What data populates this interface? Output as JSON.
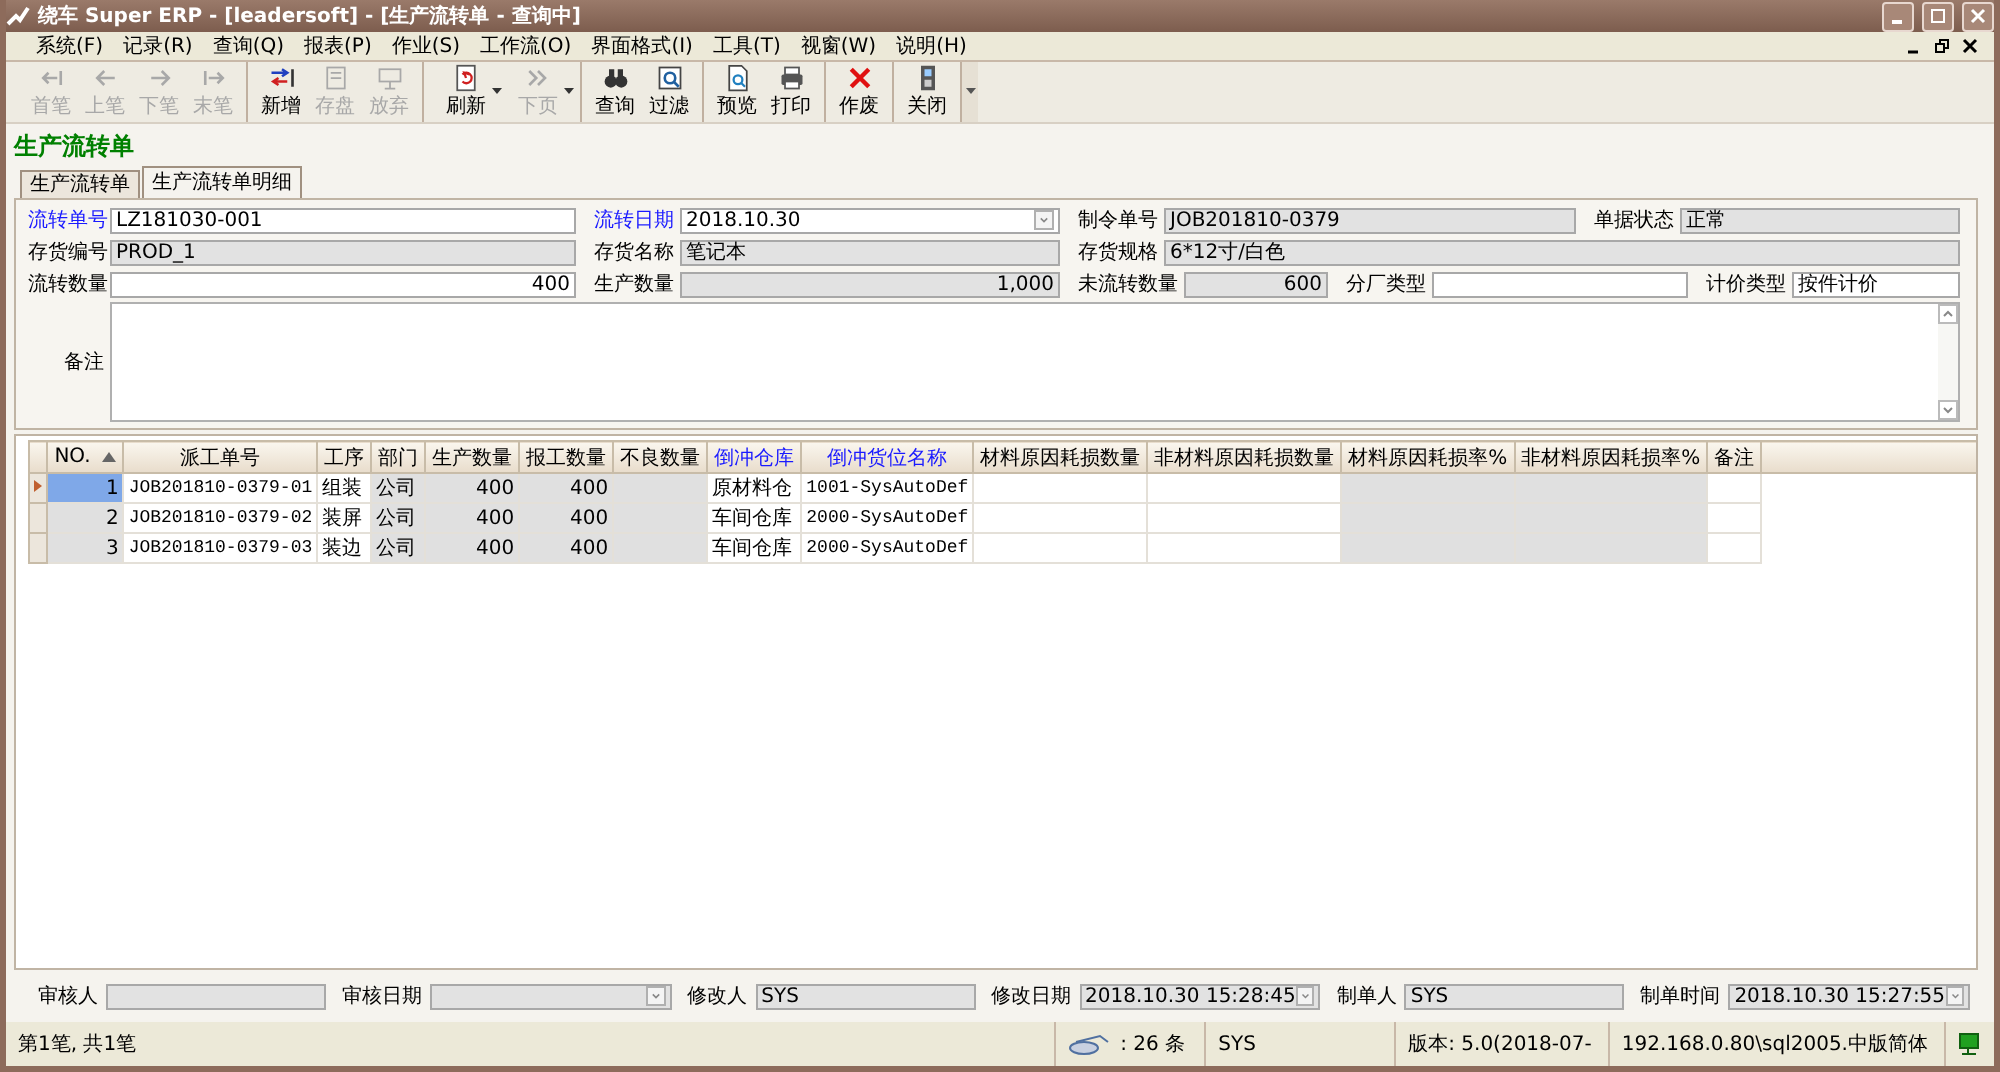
{
  "window": {
    "title": "绕车 Super ERP - [leadersoft] - [生产流转单 - 查询中]"
  },
  "menu": [
    "系统(F)",
    "记录(R)",
    "查询(Q)",
    "报表(P)",
    "作业(S)",
    "工作流(O)",
    "界面格式(I)",
    "工具(T)",
    "视窗(W)",
    "说明(H)"
  ],
  "toolbar_groups": [
    {
      "buttons": [
        {
          "label": "首笔",
          "disabled": true,
          "dropdown": false
        },
        {
          "label": "上笔",
          "disabled": true,
          "dropdown": false
        },
        {
          "label": "下笔",
          "disabled": true,
          "dropdown": false
        },
        {
          "label": "末笔",
          "disabled": true,
          "dropdown": false
        }
      ]
    },
    {
      "buttons": [
        {
          "label": "新增",
          "disabled": false,
          "dropdown": false
        },
        {
          "label": "存盘",
          "disabled": true,
          "dropdown": false
        },
        {
          "label": "放弃",
          "disabled": true,
          "dropdown": false
        }
      ]
    },
    {
      "buttons": [
        {
          "label": "刷新",
          "disabled": false,
          "dropdown": true
        },
        {
          "label": "下页",
          "disabled": true,
          "dropdown": true
        }
      ]
    },
    {
      "buttons": [
        {
          "label": "查询",
          "disabled": false,
          "dropdown": false
        },
        {
          "label": "过滤",
          "disabled": false,
          "dropdown": false
        }
      ]
    },
    {
      "buttons": [
        {
          "label": "预览",
          "disabled": false,
          "dropdown": false
        },
        {
          "label": "打印",
          "disabled": false,
          "dropdown": false
        }
      ]
    },
    {
      "buttons": [
        {
          "label": "作废",
          "disabled": false,
          "dropdown": false
        }
      ]
    },
    {
      "buttons": [
        {
          "label": "关闭",
          "disabled": false,
          "dropdown": false
        }
      ]
    }
  ],
  "page_title": "生产流转单",
  "tabs": [
    {
      "label": "生产流转单",
      "selected": false
    },
    {
      "label": "生产流转单明细",
      "selected": true
    }
  ],
  "form_rows": [
    [
      {
        "label": "流转单号",
        "value": "LZ181030-001",
        "required": true,
        "readonly": false,
        "numeric": false,
        "dropdown": false
      },
      {
        "label": "流转日期",
        "value": "2018.10.30",
        "required": true,
        "readonly": false,
        "numeric": false,
        "dropdown": true
      },
      {
        "label": "制令单号",
        "value": "JOB201810-0379",
        "required": false,
        "readonly": true,
        "numeric": false,
        "dropdown": false
      },
      {
        "label": "单据状态",
        "value": "正常",
        "required": false,
        "readonly": true,
        "numeric": false,
        "dropdown": false
      }
    ],
    [
      {
        "label": "存货编号",
        "value": "PROD_1",
        "required": false,
        "readonly": true,
        "numeric": false,
        "dropdown": false
      },
      {
        "label": "存货名称",
        "value": "笔记本",
        "required": false,
        "readonly": true,
        "numeric": false,
        "dropdown": false
      },
      {
        "label": "存货规格",
        "value": "6*12寸/白色",
        "required": false,
        "readonly": true,
        "numeric": false,
        "dropdown": false
      }
    ],
    [
      {
        "label": "流转数量",
        "value": "400",
        "required": false,
        "readonly": false,
        "numeric": true,
        "dropdown": false
      },
      {
        "label": "生产数量",
        "value": "1,000",
        "required": false,
        "readonly": true,
        "numeric": true,
        "dropdown": false
      },
      {
        "label": "未流转数量",
        "value": "600",
        "required": false,
        "readonly": true,
        "numeric": true,
        "dropdown": false
      },
      {
        "label": "分厂类型",
        "required": false,
        "readonly": false,
        "dropdown": false
      },
      {
        "label": "计价类型",
        "value": "按件计价",
        "required": false,
        "readonly": false,
        "numeric": false,
        "dropdown": false
      }
    ]
  ],
  "remarks": {
    "label": "备注"
  },
  "table": {
    "columns": [
      {
        "label": "NO.",
        "required": false,
        "readonly": true,
        "numeric": true,
        "sorted": true
      },
      {
        "label": "派工单号",
        "required": false,
        "readonly": false,
        "numeric": false,
        "sorted": false
      },
      {
        "label": "工序",
        "required": false,
        "readonly": false,
        "numeric": false,
        "sorted": false
      },
      {
        "label": "部门",
        "required": false,
        "readonly": true,
        "numeric": false,
        "sorted": false
      },
      {
        "label": "生产数量",
        "required": false,
        "readonly": true,
        "numeric": true,
        "sorted": false
      },
      {
        "label": "报工数量",
        "required": false,
        "readonly": true,
        "numeric": true,
        "sorted": false
      },
      {
        "label": "不良数量",
        "required": false,
        "readonly": true,
        "sorted": false
      },
      {
        "label": "倒冲仓库",
        "required": true,
        "readonly": false,
        "numeric": false,
        "sorted": false
      },
      {
        "label": "倒冲货位名称",
        "required": true,
        "readonly": false,
        "numeric": false,
        "sorted": false
      },
      {
        "label": "材料原因耗损数量",
        "required": false,
        "readonly": false,
        "sorted": false
      },
      {
        "label": "非材料原因耗损数量",
        "required": false,
        "readonly": false,
        "sorted": false
      },
      {
        "label": "材料原因耗损率%",
        "required": false,
        "readonly": true,
        "sorted": false
      },
      {
        "label": "非材料原因耗损率%",
        "required": false,
        "readonly": true,
        "sorted": false
      },
      {
        "label": "备注",
        "required": false,
        "readonly": false,
        "numeric": false,
        "sorted": false
      }
    ],
    "rows": [
      {
        "selected": true,
        "cells": [
          "1",
          "JOB201810-0379-01",
          "组装",
          "公司",
          "400",
          "400",
          null,
          "原材料仓",
          "1001-SysAutoDef"
        ]
      },
      {
        "selected": false,
        "cells": [
          "2",
          "JOB201810-0379-02",
          "装屏",
          "公司",
          "400",
          "400",
          null,
          "车间仓库",
          "2000-SysAutoDef"
        ]
      },
      {
        "selected": false,
        "cells": [
          "3",
          "JOB201810-0379-03",
          "装边",
          "公司",
          "400",
          "400",
          null,
          "车间仓库",
          "2000-SysAutoDef"
        ]
      }
    ]
  },
  "footer_fields": [
    {
      "label": "审核人",
      "readonly": true,
      "dropdown": false
    },
    {
      "label": "审核日期",
      "readonly": true,
      "dropdown": true
    },
    {
      "label": "修改人",
      "value": "SYS",
      "readonly": true,
      "dropdown": false
    },
    {
      "label": "修改日期",
      "value": "2018.10.30 15:28:45",
      "readonly": true,
      "dropdown": true
    },
    {
      "label": "制单人",
      "value": "SYS",
      "readonly": true,
      "dropdown": false
    },
    {
      "label": "制单时间",
      "value": "2018.10.30 15:27:55",
      "readonly": true,
      "dropdown": true
    }
  ],
  "status_bar": [
    "第1笔, 共1笔",
    ": 26 条",
    "SYS",
    "版本: 5.0(2018-07-",
    "192.168.0.80\\sql2005.中版简体"
  ]
}
